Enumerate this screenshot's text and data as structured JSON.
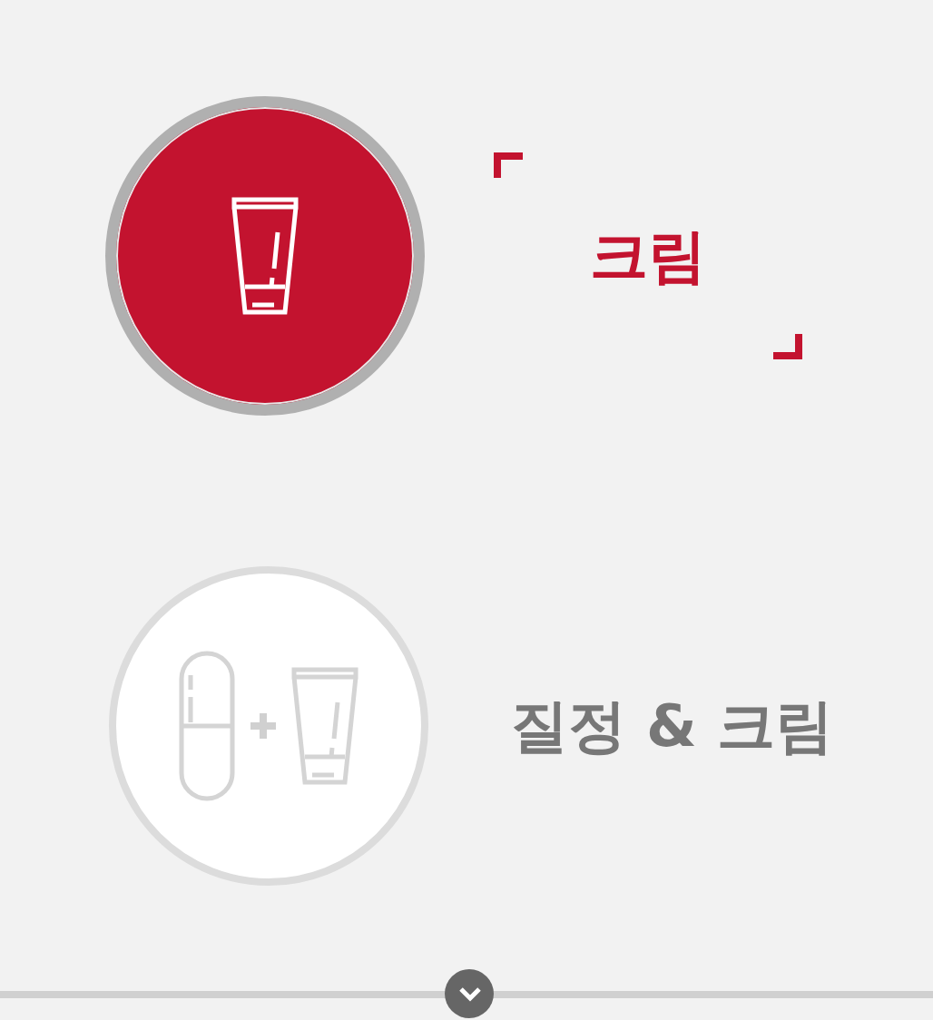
{
  "options": [
    {
      "kind": "cream",
      "label": "크림",
      "selected": true
    },
    {
      "kind": "combo",
      "label": "질정 & 크림",
      "selected": false
    }
  ],
  "scroll_down": {
    "kind": "chevron"
  }
}
